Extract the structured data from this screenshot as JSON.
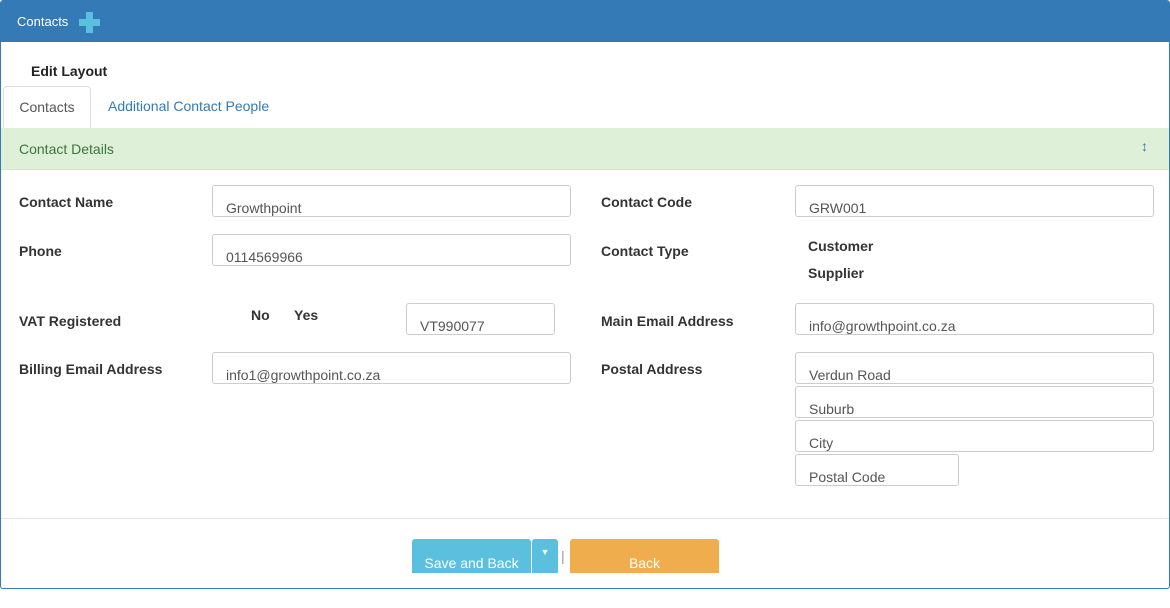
{
  "header": {
    "title": "Contacts",
    "add_icon": "plus-icon"
  },
  "edit_layout": "Edit Layout",
  "tabs": [
    {
      "label": "Contacts",
      "active": true
    },
    {
      "label": "Additional Contact People",
      "active": false
    }
  ],
  "section": {
    "title": "Contact Details",
    "toggle_icon": "vertical-arrows-icon",
    "toggle_glyph": "↕"
  },
  "form": {
    "contact_name": {
      "label": "Contact Name",
      "value": "Growthpoint"
    },
    "phone": {
      "label": "Phone",
      "value": "0114569966"
    },
    "vat": {
      "label": "VAT Registered",
      "option_no": "No",
      "option_yes": "Yes",
      "number": "VT990077"
    },
    "billing_email": {
      "label": "Billing Email Address",
      "value": "info1@growthpoint.co.za"
    },
    "contact_code": {
      "label": "Contact Code",
      "value": "GRW001"
    },
    "contact_type": {
      "label": "Contact Type",
      "option_customer": "Customer",
      "option_supplier": "Supplier"
    },
    "main_email": {
      "label": "Main Email Address",
      "value": "info@growthpoint.co.za"
    },
    "postal": {
      "label": "Postal Address",
      "street": "Verdun Road",
      "suburb": "Suburb",
      "city": "City",
      "postal_code": "Postal Code"
    }
  },
  "footer": {
    "save_label": "Save and Back",
    "caret_glyph": "▼",
    "separator": "|",
    "back_label": "Back"
  },
  "colors": {
    "primary": "#337ab7",
    "info": "#5bc0de",
    "warning": "#f0ad4e",
    "success_bg": "#dff0d8",
    "success_text": "#3c763d"
  }
}
